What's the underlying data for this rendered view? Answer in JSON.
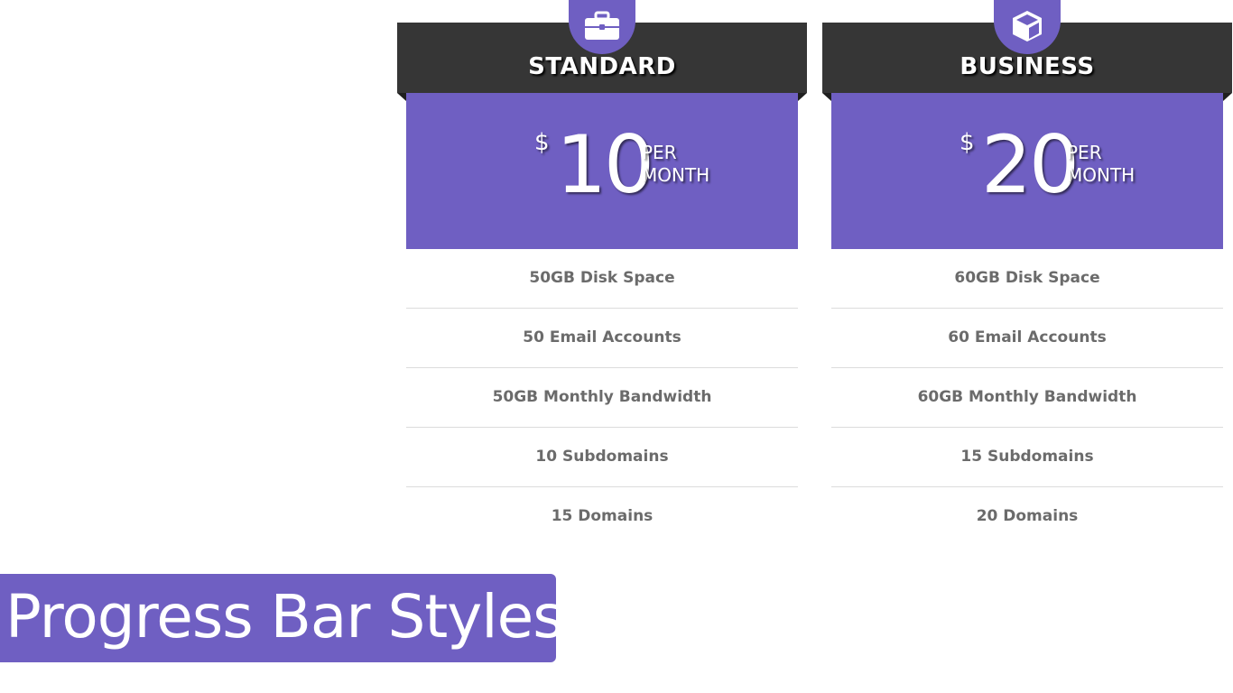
{
  "plans": [
    {
      "name": "STANDARD",
      "icon": "briefcase-icon",
      "currency": "$",
      "price": "10",
      "period_line1": "PER",
      "period_line2": "MONTH",
      "features": [
        "50GB Disk Space",
        "50 Email Accounts",
        "50GB Monthly Bandwidth",
        "10 Subdomains",
        "15 Domains"
      ]
    },
    {
      "name": "BUSINESS",
      "icon": "cube-icon",
      "currency": "$",
      "price": "20",
      "period_line1": "PER",
      "period_line2": "MONTH",
      "features": [
        "60GB Disk Space",
        "60 Email Accounts",
        "60GB Monthly Bandwidth",
        "15 Subdomains",
        "20 Domains"
      ]
    }
  ],
  "banner": {
    "title": "Progress Bar Styles"
  },
  "colors": {
    "accent": "#6f5fc2",
    "header_dark": "#363636",
    "feature_text": "#6b6b6b",
    "divider": "#dcdcdc"
  }
}
